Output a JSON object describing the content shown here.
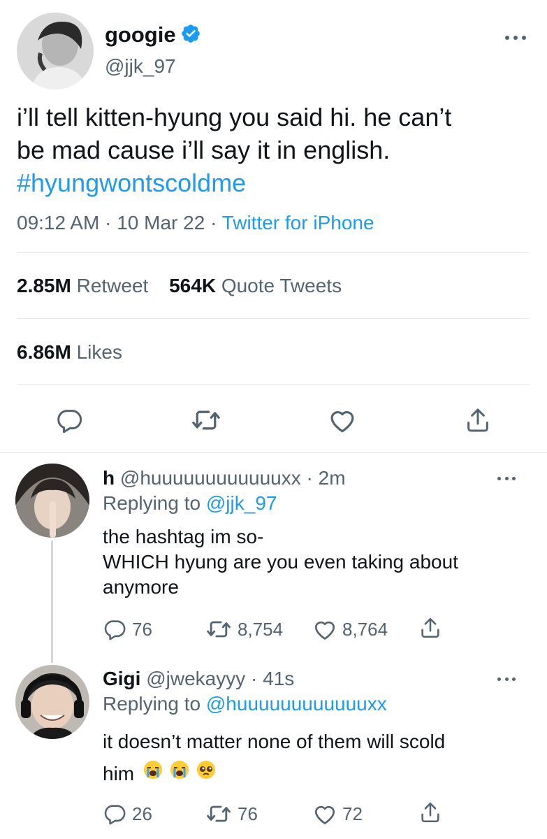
{
  "main_tweet": {
    "display_name": "googie",
    "handle": "@jjk_97",
    "text_line1": "i’ll tell kitten-hyung you said hi. he can’t",
    "text_line2": "be mad cause i’ll say it in english.",
    "hashtag": "#hyungwontscoldme",
    "time": "09:12 AM",
    "sep1": "·",
    "date": "10 Mar 22",
    "sep2": "·",
    "source": "Twitter for iPhone",
    "retweets_count": "2.85M",
    "retweets_label": "Retweet",
    "quotes_count": "564K",
    "quotes_label": "Quote Tweets",
    "likes_count": "6.86M",
    "likes_label": "Likes"
  },
  "replies": [
    {
      "display_name": "h",
      "handle": "@huuuuuuuuuuuuxx",
      "time_sep": "·",
      "time": "2m",
      "replying_label": "Replying to",
      "replying_to": "@jjk_97",
      "text_line1": "the hashtag im so-",
      "text_line2": "WHICH hyung are you even taking about",
      "text_line3": "anymore",
      "reply_count": "76",
      "retweet_count": "8,754",
      "like_count": "8,764"
    },
    {
      "display_name": "Gigi",
      "handle": "@jwekayyy",
      "time_sep": "·",
      "time": "41s",
      "replying_label": "Replying to",
      "replying_to": "@huuuuuuuuuuuuxx",
      "text_line1": "it doesn’t matter none of them will scold",
      "text_line2": "him",
      "emojis": [
        "loudly-crying-face",
        "loudly-crying-face",
        "pleading-face"
      ],
      "reply_count": "26",
      "retweet_count": "76",
      "like_count": "72"
    }
  ],
  "colors": {
    "accent": "#1d9bf0",
    "text": "#0f1419",
    "secondary": "#536471",
    "divider": "#e6e9ec"
  }
}
